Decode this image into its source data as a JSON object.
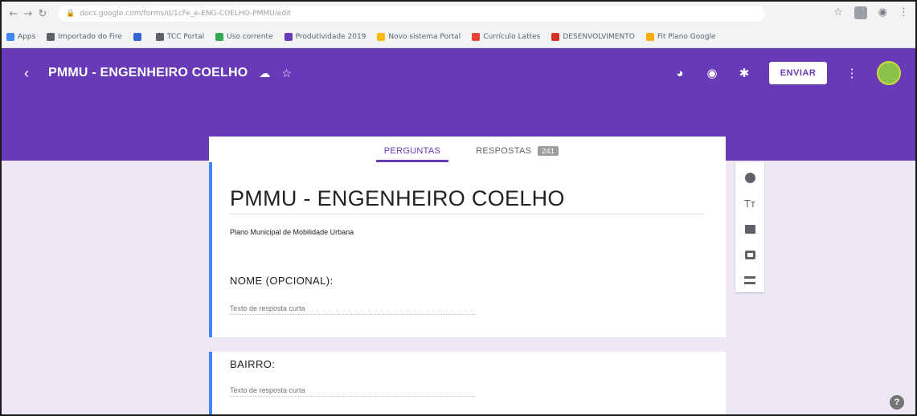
{
  "browser": {
    "url": "docs.google.com/forms/d/1cFe_e-ENG-COELHO-PMMU/edit",
    "bookmarks": [
      {
        "label": "Apps",
        "color": "#4285f4"
      },
      {
        "label": "Importado do Fire",
        "color": "#5f6368"
      },
      {
        "label": "",
        "color": "#3367d6"
      },
      {
        "label": "TCC Portal",
        "color": "#5f6368"
      },
      {
        "label": "Uso corrente",
        "color": "#34a853"
      },
      {
        "label": "Produtividade 2019",
        "color": "#673ab7"
      },
      {
        "label": "Novo sistema Portal",
        "color": "#fbbc04"
      },
      {
        "label": "Currículo Lattes",
        "color": "#ea4335"
      },
      {
        "label": "DESENVOLVIMENTO",
        "color": "#d93025"
      },
      {
        "label": "Fit Plano Google",
        "color": "#f9ab00"
      }
    ]
  },
  "header": {
    "title": "PMMU - ENGENHEIRO COELHO",
    "send_label": "ENVIAR"
  },
  "tabs": [
    {
      "label": "PERGUNTAS",
      "active": true
    },
    {
      "label": "RESPOSTAS",
      "active": false,
      "count": "241"
    }
  ],
  "form": {
    "title": "PMMU - ENGENHEIRO COELHO",
    "description": "Plano Municipal de Mobilidade Urbana",
    "questions": [
      {
        "label": "NOME (OPCIONAL):",
        "placeholder": "Texto de resposta curta"
      },
      {
        "label": "BAIRRO:",
        "placeholder": "Texto de resposta curta"
      }
    ]
  },
  "side_toolbar": {
    "icons": [
      "add-question-icon",
      "add-title-icon",
      "add-image-icon",
      "add-video-icon",
      "add-section-icon"
    ]
  },
  "colors": {
    "brand": "#673ab7",
    "canvas": "#ede7f6",
    "active_card_accent": "#4285f4"
  }
}
